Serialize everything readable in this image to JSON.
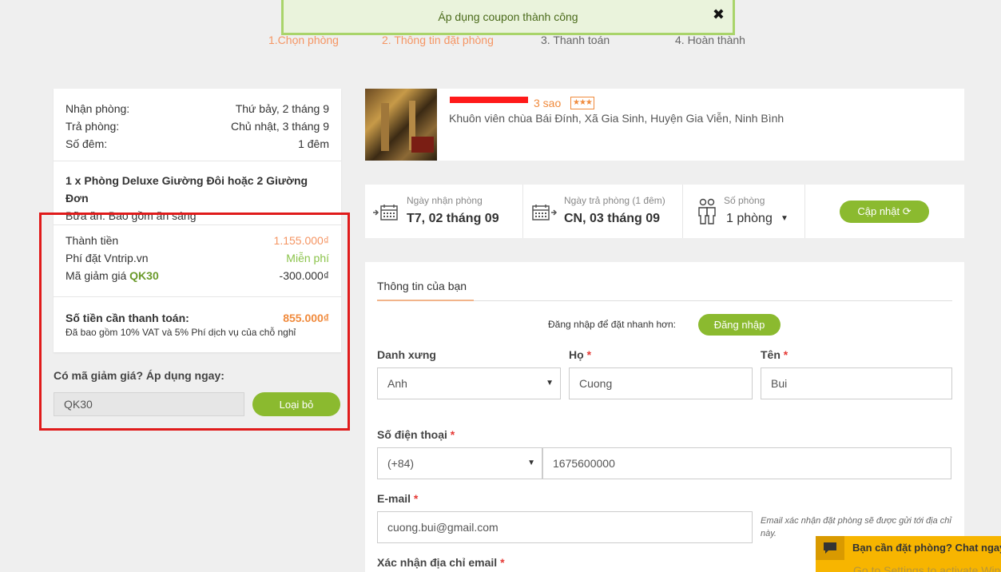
{
  "toast": {
    "message": "Áp dụng coupon thành công",
    "close": "✖"
  },
  "steps": [
    "1.Chọn phòng",
    "2. Thông tin đặt phòng",
    "3. Thanh toán",
    "4. Hoàn thành"
  ],
  "summary": {
    "checkin_label": "Nhận phòng:",
    "checkin_value": "Thứ bảy, 2 tháng 9",
    "checkout_label": "Trả phòng:",
    "checkout_value": "Chủ nhật, 3 tháng 9",
    "nights_label": "Số đêm:",
    "nights_value": "1 đêm",
    "room_title": "1 x Phòng Deluxe Giường Đôi hoặc 2 Giường Đơn",
    "meal": "Bữa ăn: Bao gồm ăn sáng",
    "subtotal_label": "Thành tiền",
    "subtotal_value": "1.155.000₫",
    "fee_label": "Phí đặt Vntrip.vn",
    "fee_value": "Miễn phí",
    "discount_label": "Mã giảm giá",
    "discount_code": "QK30",
    "discount_value": "-300.000₫",
    "total_label": "Số tiền cần thanh toán:",
    "total_value": "855.000₫",
    "vat_note": "Đã bao gồm 10% VAT và 5% Phí dịch vụ của chỗ nghỉ"
  },
  "coupon": {
    "title": "Có mã giảm giá? Áp dụng ngay:",
    "value": "QK30",
    "remove_label": "Loại bỏ"
  },
  "hotel": {
    "stars_text": "3 sao",
    "stars_badge": "★★★",
    "address": "Khuôn viên chùa Bái Đính, Xã Gia Sinh, Huyện Gia Viễn, Ninh Bình"
  },
  "dates": {
    "checkin_label": "Ngày nhận phòng",
    "checkin_value": "T7, 02 tháng 09",
    "checkout_label": "Ngày trả phòng (1 đêm)",
    "checkout_value": "CN, 03 tháng 09",
    "rooms_label": "Số phòng",
    "rooms_value": "1 phòng",
    "update_label": "Cập nhật ⟳"
  },
  "form": {
    "tab": "Thông tin của bạn",
    "login_hint": "Đăng nhập để đặt nhanh hơn:",
    "login_button": "Đăng nhập",
    "salutation_label": "Danh xưng",
    "salutation_value": "Anh",
    "lastname_label": "Họ",
    "lastname_value": "Cuong",
    "firstname_label": "Tên",
    "firstname_value": "Bui",
    "phone_label": "Số điện thoại",
    "phone_code": "(+84)",
    "phone_value": "1675600000",
    "email_label": "E-mail",
    "email_value": "cuong.bui@gmail.com",
    "email_note": "Email xác nhận đặt phòng sẽ được gửi tới địa chỉ này.",
    "confirm_email_label": "Xác nhận địa chỉ email",
    "required_mark": "*"
  },
  "chat": {
    "text": "Bạn cần đặt phòng? Chat ngay"
  },
  "watermark": "Go to Settings to activate Windows."
}
